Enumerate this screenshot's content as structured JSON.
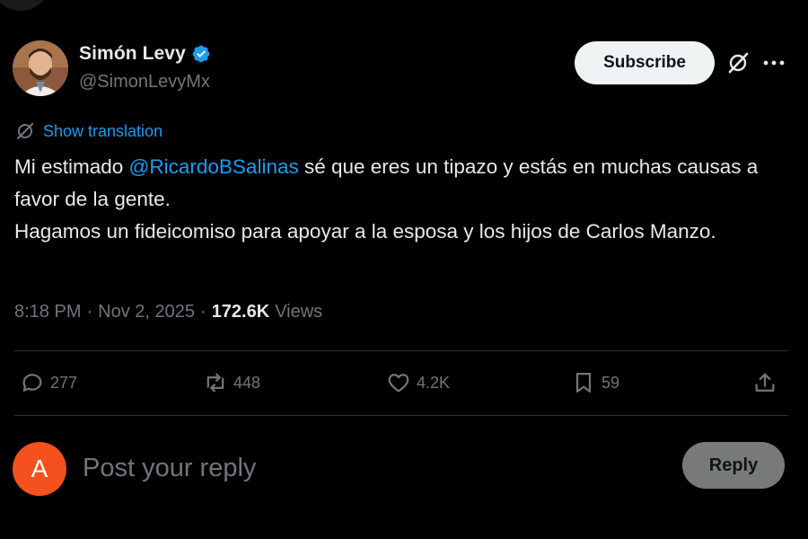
{
  "author": {
    "display_name": "Simón Levy",
    "handle": "@SimonLevyMx",
    "verified_icon": "verified-badge-icon"
  },
  "header": {
    "subscribe_label": "Subscribe",
    "grok_icon": "grok-icon",
    "more_icon": "more-icon"
  },
  "tweet": {
    "translate_label": "Show translation",
    "text_before_mention": "Mi estimado ",
    "mention": "@RicardoBSalinas",
    "text_after_mention": " sé que eres un tipazo y estás en muchas causas a favor de la gente.",
    "text_line2": "Hagamos un fideicomiso para apoyar a la esposa y los hijos de Carlos Manzo.",
    "time": "8:18 PM",
    "date": "Nov 2, 2025",
    "views_count": "172.6K",
    "views_label": "Views"
  },
  "actions": {
    "replies": "277",
    "reposts": "448",
    "likes": "4.2K",
    "bookmarks": "59"
  },
  "reply_box": {
    "avatar_letter": "A",
    "placeholder": "Post your reply",
    "button_label": "Reply"
  },
  "colors": {
    "background": "#000000",
    "text": "#e7e9ea",
    "muted": "#71767b",
    "link": "#1d9bf0",
    "verified": "#1d9bf0",
    "reply_avatar": "#f4511e"
  }
}
